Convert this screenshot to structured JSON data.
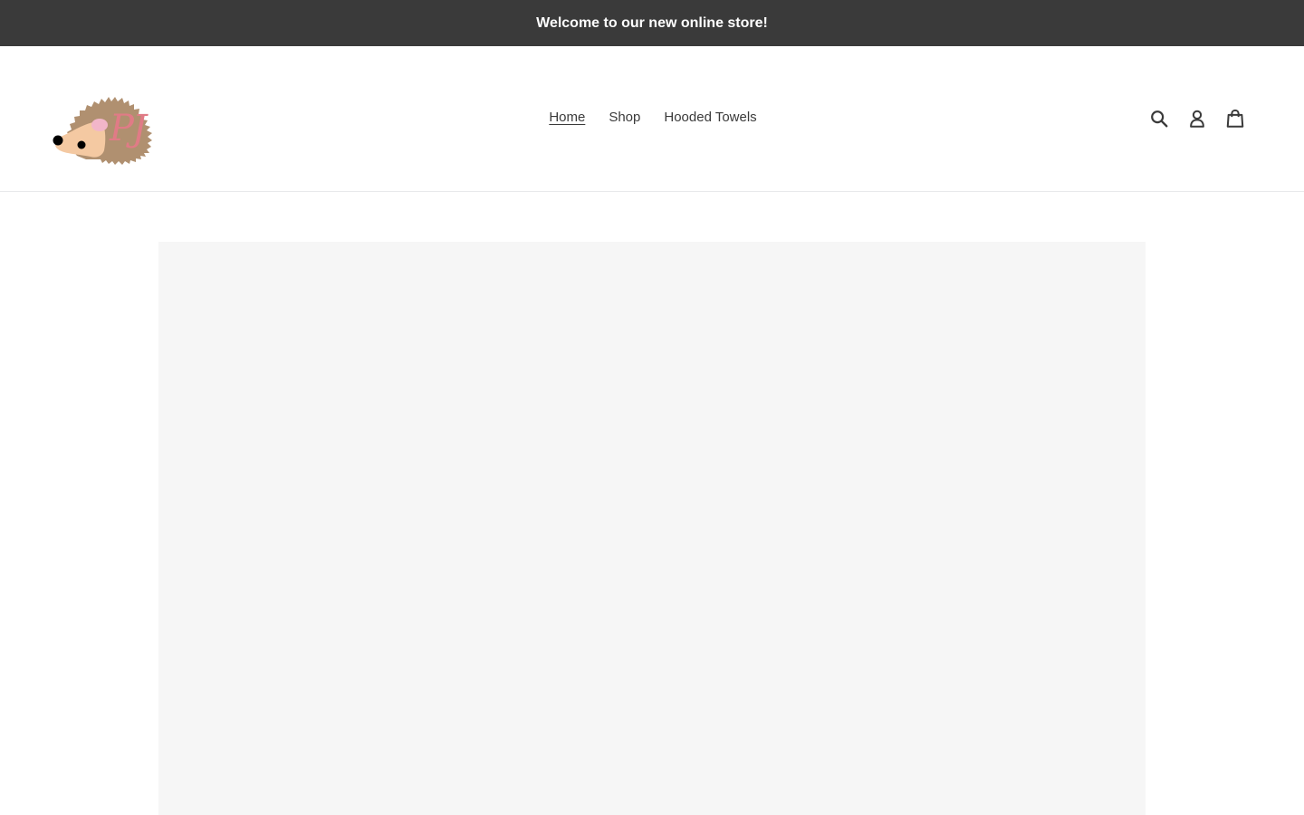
{
  "announcement": {
    "text": "Welcome to our new online store!"
  },
  "header": {
    "logo": {
      "letters": "PJ"
    },
    "nav": [
      {
        "label": "Home",
        "active": true
      },
      {
        "label": "Shop",
        "active": false
      },
      {
        "label": "Hooded Towels",
        "active": false
      }
    ],
    "icons": [
      "search-icon",
      "account-icon",
      "cart-icon"
    ]
  },
  "colors": {
    "announcement_bg": "#3a3a3a",
    "text": "#3a3a3a",
    "hero_placeholder": "#f6f6f6",
    "logo_body": "#b09070",
    "logo_face": "#f4c9a2",
    "logo_ear": "#f2b6c9",
    "logo_letters": "#e07b86"
  }
}
